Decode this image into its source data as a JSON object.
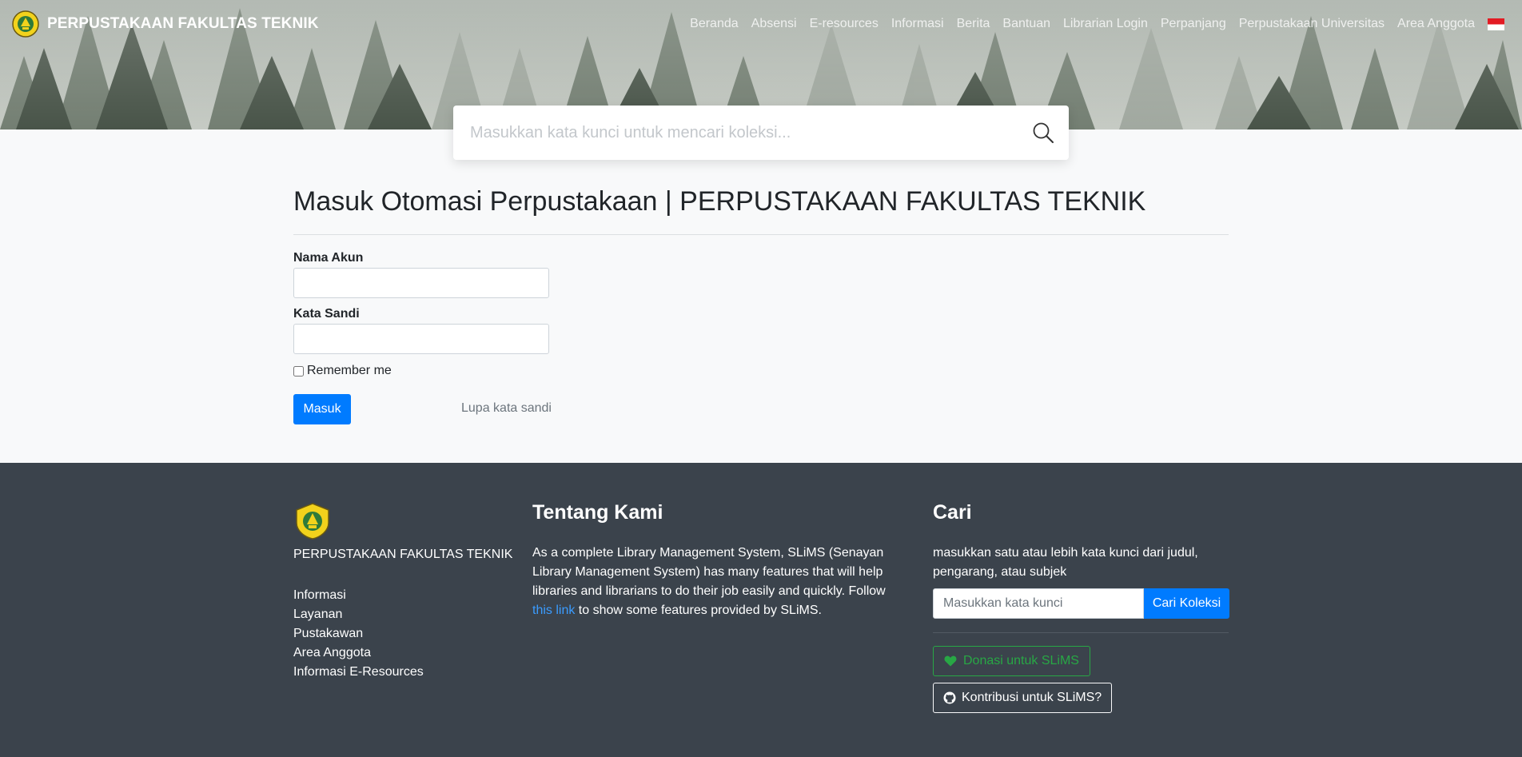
{
  "header": {
    "brand_name": "PERPUSTAKAAN FAKULTAS TEKNIK",
    "nav": [
      "Beranda",
      "Absensi",
      "E-resources",
      "Informasi",
      "Berita",
      "Bantuan",
      "Librarian Login",
      "Perpanjang",
      "Perpustakaan Universitas",
      "Area Anggota"
    ],
    "language_flag": "indonesia-flag-icon"
  },
  "search": {
    "placeholder": "Masukkan kata kunci untuk mencari koleksi..."
  },
  "login": {
    "title": "Masuk Otomasi Perpustakaan | PERPUSTAKAAN FAKULTAS TEKNIK",
    "username_label": "Nama Akun",
    "username_value": "",
    "password_label": "Kata Sandi",
    "password_value": "",
    "remember_label": "Remember me",
    "submit_label": "Masuk",
    "forgot_label": "Lupa kata sandi"
  },
  "footer": {
    "brand_name": "PERPUSTAKAAN FAKULTAS TEKNIK",
    "links": [
      "Informasi",
      "Layanan",
      "Pustakawan",
      "Area Anggota",
      "Informasi E-Resources"
    ],
    "about_heading": "Tentang Kami",
    "about_text_before": "As a complete Library Management System, SLiMS (Senayan Library Management System) has many features that will help libraries and librarians to do their job easily and quickly. Follow ",
    "about_link": "this link",
    "about_text_after": " to show some features provided by SLiMS.",
    "search_heading": "Cari",
    "search_desc": "masukkan satu atau lebih kata kunci dari judul, pengarang, atau subjek",
    "search_placeholder": "Masukkan kata kunci",
    "search_button": "Cari Koleksi",
    "donate_button": "Donasi untuk SLiMS",
    "contribute_button": "Kontribusi untuk SLiMS?"
  },
  "colors": {
    "primary": "#007bff",
    "footer_bg": "#3b434c",
    "donate_green": "#28a745",
    "link_blue": "#3b9cff"
  }
}
